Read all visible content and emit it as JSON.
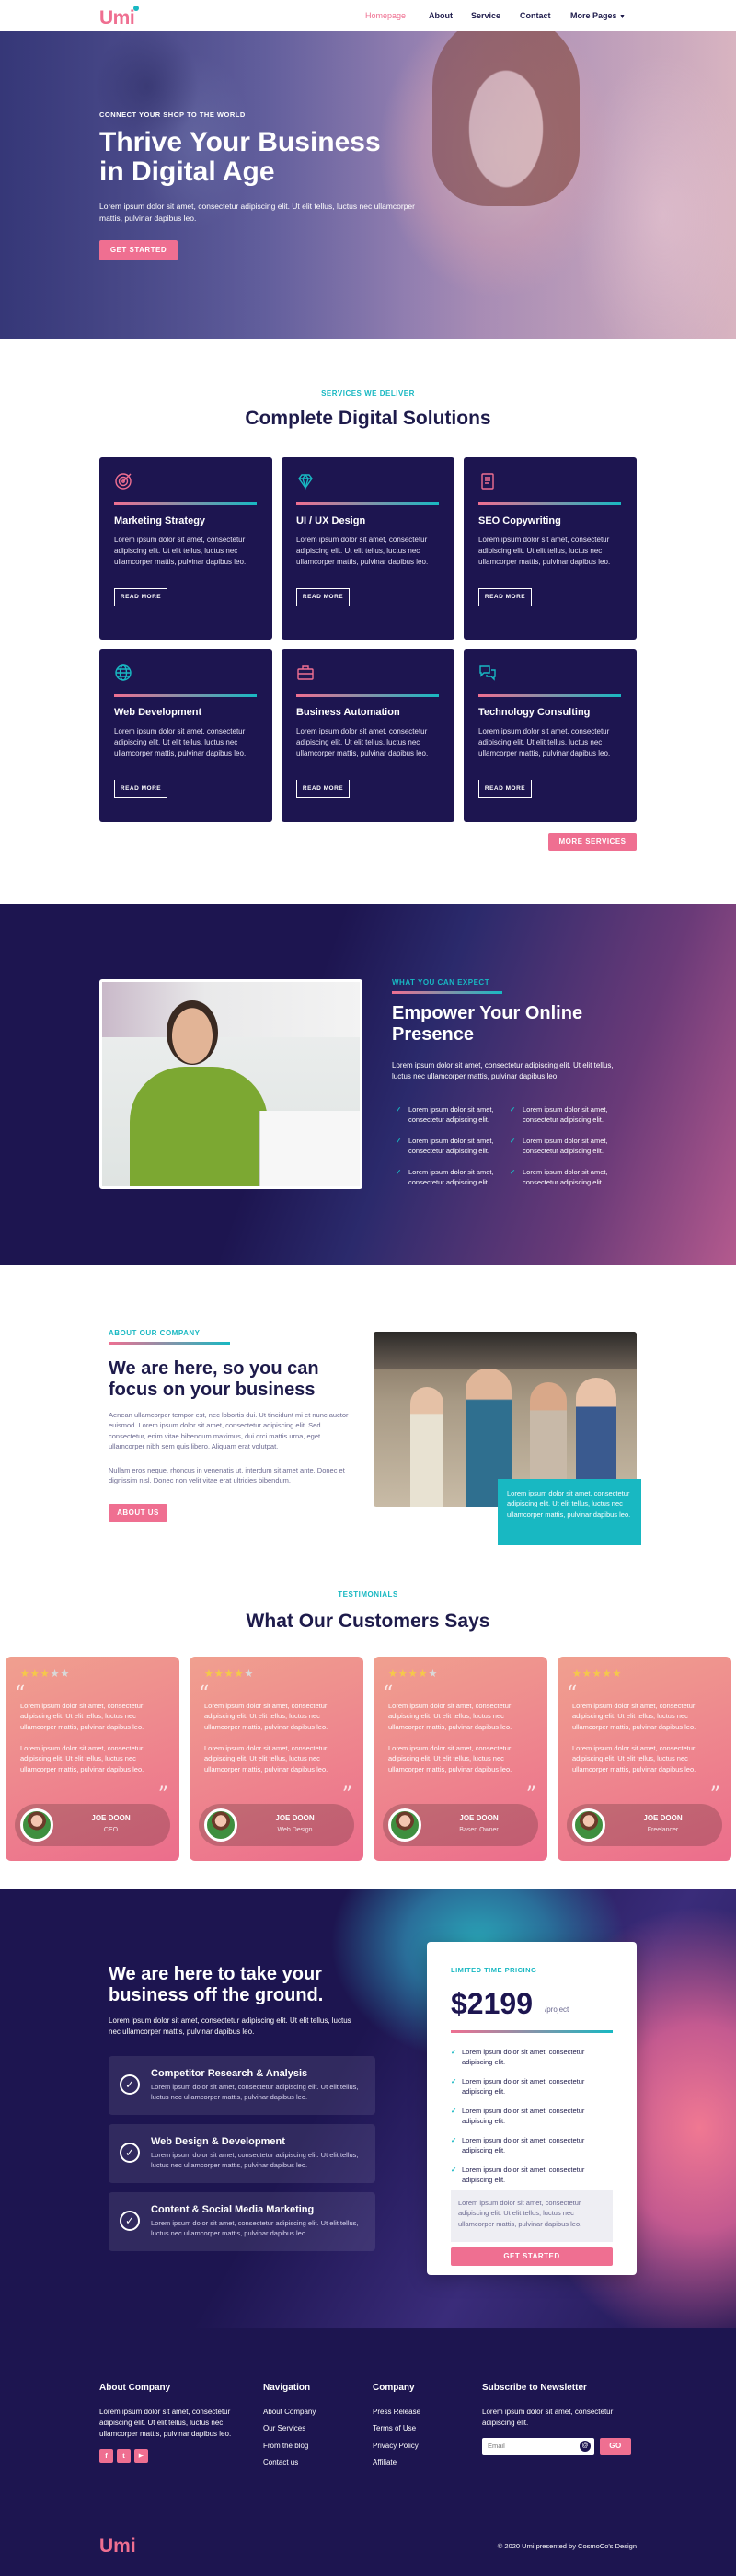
{
  "colors": {
    "pink": "#ef6f91",
    "teal": "#18b8c2",
    "navy": "#1d1550"
  },
  "nav": {
    "logo": "Umi",
    "items": [
      "Homepage",
      "About",
      "Service",
      "Contact",
      "More Pages"
    ],
    "more_chevron": "chevron-down-icon"
  },
  "hero": {
    "eyebrow": "CONNECT YOUR SHOP TO THE WORLD",
    "title_l1": "Thrive Your Business",
    "title_l2": "in Digital Age",
    "text": "Lorem ipsum dolor sit amet, consectetur adipiscing elit. Ut elit tellus, luctus nec ullamcorper mattis, pulvinar dapibus leo.",
    "cta": "GET STARTED"
  },
  "services": {
    "eyebrow": "SERVICES WE DELIVER",
    "title": "Complete Digital Solutions",
    "more": "MORE SERVICES",
    "cards": [
      {
        "icon": "target-icon",
        "title": "Marketing Strategy",
        "text": "Lorem ipsum dolor sit amet, consectetur adipiscing elit. Ut elit tellus, luctus nec ullamcorper mattis, pulvinar dapibus leo.",
        "button": "READ MORE"
      },
      {
        "icon": "diamond-icon",
        "title": "UI / UX Design",
        "text": "Lorem ipsum dolor sit amet, consectetur adipiscing elit. Ut elit tellus, luctus nec ullamcorper mattis, pulvinar dapibus leo.",
        "button": "READ MORE"
      },
      {
        "icon": "document-icon",
        "title": "SEO Copywriting",
        "text": "Lorem ipsum dolor sit amet, consectetur adipiscing elit. Ut elit tellus, luctus nec ullamcorper mattis, pulvinar dapibus leo.",
        "button": "READ MORE"
      },
      {
        "icon": "globe-icon",
        "title": "Web Development",
        "text": "Lorem ipsum dolor sit amet, consectetur adipiscing elit. Ut elit tellus, luctus nec ullamcorper mattis, pulvinar dapibus leo.",
        "button": "READ MORE"
      },
      {
        "icon": "briefcase-icon",
        "title": "Business Automation",
        "text": "Lorem ipsum dolor sit amet, consectetur adipiscing elit. Ut elit tellus, luctus nec ullamcorper mattis, pulvinar dapibus leo.",
        "button": "READ MORE"
      },
      {
        "icon": "chat-icon",
        "title": "Technology Consulting",
        "text": "Lorem ipsum dolor sit amet, consectetur adipiscing elit. Ut elit tellus, luctus nec ullamcorper mattis, pulvinar dapibus leo.",
        "button": "READ MORE"
      }
    ]
  },
  "expect": {
    "eyebrow": "WHAT YOU CAN EXPECT",
    "title_l1": "Empower Your Online",
    "title_l2": "Presence",
    "text": "Lorem ipsum dolor sit amet, consectetur adipiscing elit. Ut elit tellus, luctus nec ullamcorper mattis, pulvinar dapibus leo.",
    "items": [
      "Lorem ipsum dolor sit amet, consectetur adipiscing elit.",
      "Lorem ipsum dolor sit amet, consectetur adipiscing elit.",
      "Lorem ipsum dolor sit amet, consectetur adipiscing elit.",
      "Lorem ipsum dolor sit amet, consectetur adipiscing elit.",
      "Lorem ipsum dolor sit amet, consectetur adipiscing elit.",
      "Lorem ipsum dolor sit amet, consectetur adipiscing elit."
    ]
  },
  "about": {
    "eyebrow": "ABOUT OUR COMPANY",
    "title_l1": "We are here, so you can",
    "title_l2": "focus on your business",
    "p1": "Aenean ullamcorper tempor est, nec lobortis dui. Ut tincidunt mi et nunc auctor euismod. Lorem ipsum dolor sit amet, consectetur adipiscing elit. Sed consectetur, enim vitae bibendum maximus, dui orci mattis urna, eget ullamcorper nibh sem quis libero. Aliquam erat volutpat.",
    "p2": "Nullam eros neque, rhoncus in venenatis ut, interdum sit amet ante. Donec et dignissim nisl. Donec non velit vitae erat ultricies bibendum.",
    "button": "ABOUT US",
    "overlay": "Lorem ipsum dolor sit amet, consectetur adipiscing elit. Ut elit tellus, luctus nec ullamcorper mattis, pulvinar dapibus leo."
  },
  "testimonials": {
    "eyebrow": "TESTIMONIALS",
    "title": "What Our Customers Says",
    "items": [
      {
        "stars": 3,
        "p1": "Lorem ipsum dolor sit amet, consectetur adipiscing elit. Ut elit tellus, luctus nec ullamcorper mattis, pulvinar dapibus leo.",
        "p2": "Lorem ipsum dolor sit amet, consectetur adipiscing elit. Ut elit tellus, luctus nec ullamcorper mattis, pulvinar dapibus leo.",
        "name": "JOE DOON",
        "role": "CEO"
      },
      {
        "stars": 4,
        "p1": "Lorem ipsum dolor sit amet, consectetur adipiscing elit. Ut elit tellus, luctus nec ullamcorper mattis, pulvinar dapibus leo.",
        "p2": "Lorem ipsum dolor sit amet, consectetur adipiscing elit. Ut elit tellus, luctus nec ullamcorper mattis, pulvinar dapibus leo.",
        "name": "JOE DOON",
        "role": "Web Design"
      },
      {
        "stars": 4,
        "p1": "Lorem ipsum dolor sit amet, consectetur adipiscing elit. Ut elit tellus, luctus nec ullamcorper mattis, pulvinar dapibus leo.",
        "p2": "Lorem ipsum dolor sit amet, consectetur adipiscing elit. Ut elit tellus, luctus nec ullamcorper mattis, pulvinar dapibus leo.",
        "name": "JOE DOON",
        "role": "Basen Owner"
      },
      {
        "stars": 5,
        "p1": "Lorem ipsum dolor sit amet, consectetur adipiscing elit. Ut elit tellus, luctus nec ullamcorper mattis, pulvinar dapibus leo.",
        "p2": "Lorem ipsum dolor sit amet, consectetur adipiscing elit. Ut elit tellus, luctus nec ullamcorper mattis, pulvinar dapibus leo.",
        "name": "JOE DOON",
        "role": "Freelancer"
      }
    ]
  },
  "pricing": {
    "title_l1": "We are here to take your",
    "title_l2": "business off the ground.",
    "text": "Lorem ipsum dolor sit amet, consectetur adipiscing elit. Ut elit tellus, luctus nec ullamcorper mattis, pulvinar dapibus leo.",
    "features": [
      {
        "title": "Competitor Research & Analysis",
        "text": "Lorem ipsum dolor sit amet, consectetur adipiscing elit. Ut elit tellus, luctus nec ullamcorper mattis, pulvinar dapibus leo."
      },
      {
        "title": "Web Design & Development",
        "text": "Lorem ipsum dolor sit amet, consectetur adipiscing elit. Ut elit tellus, luctus nec ullamcorper mattis, pulvinar dapibus leo."
      },
      {
        "title": "Content & Social Media Marketing",
        "text": "Lorem ipsum dolor sit amet, consectetur adipiscing elit. Ut elit tellus, luctus nec ullamcorper mattis, pulvinar dapibus leo."
      }
    ],
    "box": {
      "label": "LIMITED TIME PRICING",
      "price": "$2199",
      "unit": "/project",
      "items": [
        "Lorem ipsum dolor sit amet, consectetur adipiscing elit.",
        "Lorem ipsum dolor sit amet, consectetur adipiscing elit.",
        "Lorem ipsum dolor sit amet, consectetur adipiscing elit.",
        "Lorem ipsum dolor sit amet, consectetur adipiscing elit.",
        "Lorem ipsum dolor sit amet, consectetur adipiscing elit."
      ],
      "note": "Lorem ipsum dolor sit amet, consectetur adipiscing elit. Ut elit tellus, luctus nec ullamcorper mattis, pulvinar dapibus leo.",
      "button": "GET STARTED"
    }
  },
  "footer": {
    "about_title": "About Company",
    "about_text": "Lorem ipsum dolor sit amet, consectetur adipiscing elit. Ut elit tellus, luctus nec ullamcorper mattis, pulvinar dapibus leo.",
    "social": [
      "facebook-icon",
      "twitter-icon",
      "youtube-icon"
    ],
    "nav_title": "Navigation",
    "nav_links": [
      "About Company",
      "Our Services",
      "From the blog",
      "Contact us"
    ],
    "company_title": "Company",
    "company_links": [
      "Press Release",
      "Terms of Use",
      "Privacy Policy",
      "Affiliate"
    ],
    "news_title": "Subscribe to Newsletter",
    "news_text": "Lorem ipsum dolor sit amet, consectetur adipiscing elit.",
    "email_placeholder": "Email",
    "submit": "GO",
    "logo": "Umi",
    "copyright": "© 2020 Umi presented by CosmoCo's Design"
  }
}
